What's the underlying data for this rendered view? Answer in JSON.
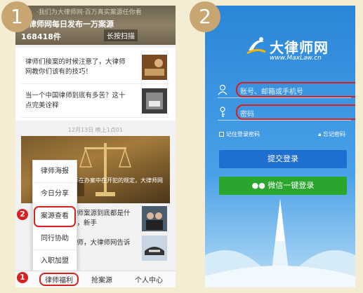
{
  "steps": {
    "one": "1",
    "two": "2"
  },
  "markers": {
    "first": "1",
    "second": "2"
  },
  "phone1": {
    "banner": {
      "line1": "·我们为大律师网·百万真实案源任你看",
      "line2": "大律师网每日发布一万案源",
      "line3": "168418件",
      "scan": "长按扫描"
    },
    "articles": [
      {
        "title": "律师们接案的时候注意了，大律师网教你们该有的技巧！"
      },
      {
        "title": "当一个中国律师到底有多苦？这十点完美诠释"
      }
    ],
    "date": "12月13日 晚上1点01",
    "banner2": {
      "text1": "关于",
      "text2": "律师在办案中在开犯的规定，大律师网为",
      "text3": "规定"
    },
    "articles2": [
      {
        "title": "律师案源到底都是什么，新手"
      },
      {
        "title": "律师，大律师网告诉"
      }
    ],
    "popup_items": [
      "律师海报",
      "今日分享",
      "案源查看",
      "同行协助",
      "入职加盟"
    ],
    "nav": {
      "item1": "律师福利",
      "item2": "抢案源",
      "item3": "个人中心"
    }
  },
  "phone2": {
    "logo_cn": "大律师网",
    "logo_en": "www.MaxLaw.cn",
    "account_placeholder": "账号、邮箱或手机号",
    "password_placeholder": "密码",
    "remember": "记住登录密码",
    "forgot": "忘记密码",
    "submit": "提交登录",
    "wechat": "微信一键登录"
  },
  "colors": {
    "badge": "#c7a672",
    "highlight": "#d9201f",
    "submit": "#1e6fd0",
    "wechat": "#2aa52e"
  }
}
